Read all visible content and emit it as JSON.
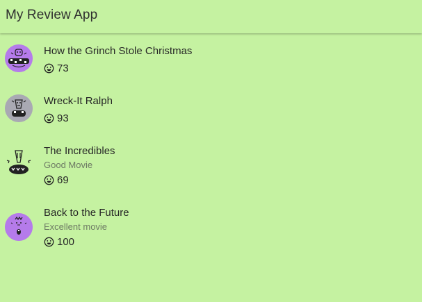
{
  "app": {
    "title": "My Review App"
  },
  "reviews": [
    {
      "title": "How the Grinch Stole Christmas",
      "subtitle": "",
      "score": "73",
      "avatar_color": "#b57bea",
      "avatar_icon": "purple-monster-icon"
    },
    {
      "title": "Wreck-It Ralph",
      "subtitle": "",
      "score": "93",
      "avatar_color": "#a9a9b3",
      "avatar_icon": "gray-monster-icon"
    },
    {
      "title": "The Incredibles",
      "subtitle": "Good Movie",
      "score": "69",
      "avatar_color": "#c5f2a1",
      "avatar_icon": "green-monster-icon"
    },
    {
      "title": "Back to the Future",
      "subtitle": "Excellent movie",
      "score": "100",
      "avatar_color": "#b57bea",
      "avatar_icon": "purple-monster-icon"
    }
  ],
  "icons": {
    "score_icon": "smile-icon"
  }
}
